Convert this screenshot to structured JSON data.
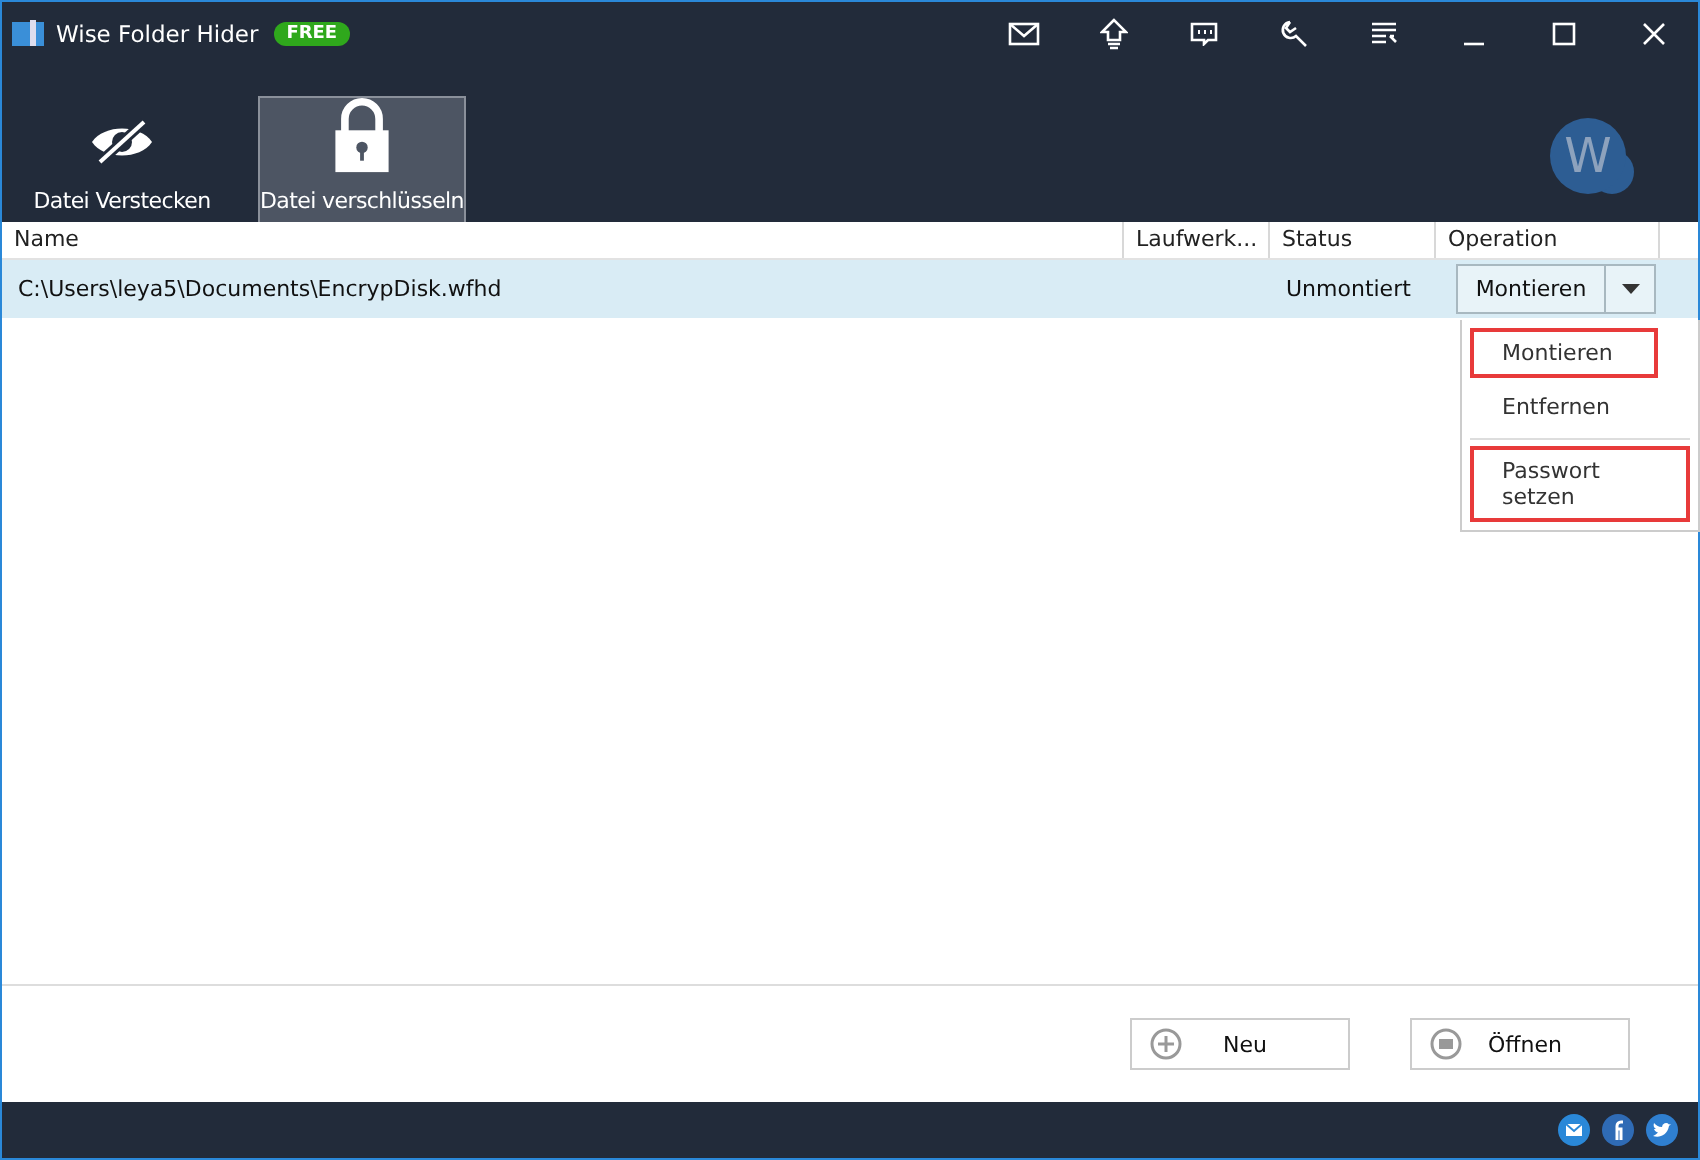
{
  "window": {
    "title": "Wise Folder Hider",
    "badge": "FREE"
  },
  "tabs": [
    {
      "label": "Datei Verstecken",
      "kind": "hide",
      "selected": false
    },
    {
      "label": "Datei verschlüsseln",
      "kind": "lock",
      "selected": true
    }
  ],
  "avatar": {
    "letter": "W"
  },
  "table": {
    "columns": [
      "Name",
      "Laufwerk...",
      "Status",
      "Operation"
    ],
    "rows": [
      {
        "name": "C:\\Users\\leya5\\Documents\\EncrypDisk.wfhd",
        "drive": "",
        "status": "Unmontiert",
        "operation": "Montieren",
        "selected": true
      }
    ]
  },
  "dropdown_menu": {
    "items": [
      {
        "label": "Montieren",
        "highlighted": true
      },
      {
        "label": "Entfernen",
        "highlighted": false
      },
      {
        "label": "Passwort setzen",
        "highlighted": true
      }
    ]
  },
  "buttons": [
    {
      "label": "Neu",
      "kind": "new"
    },
    {
      "label": "Öffnen",
      "kind": "open"
    }
  ]
}
